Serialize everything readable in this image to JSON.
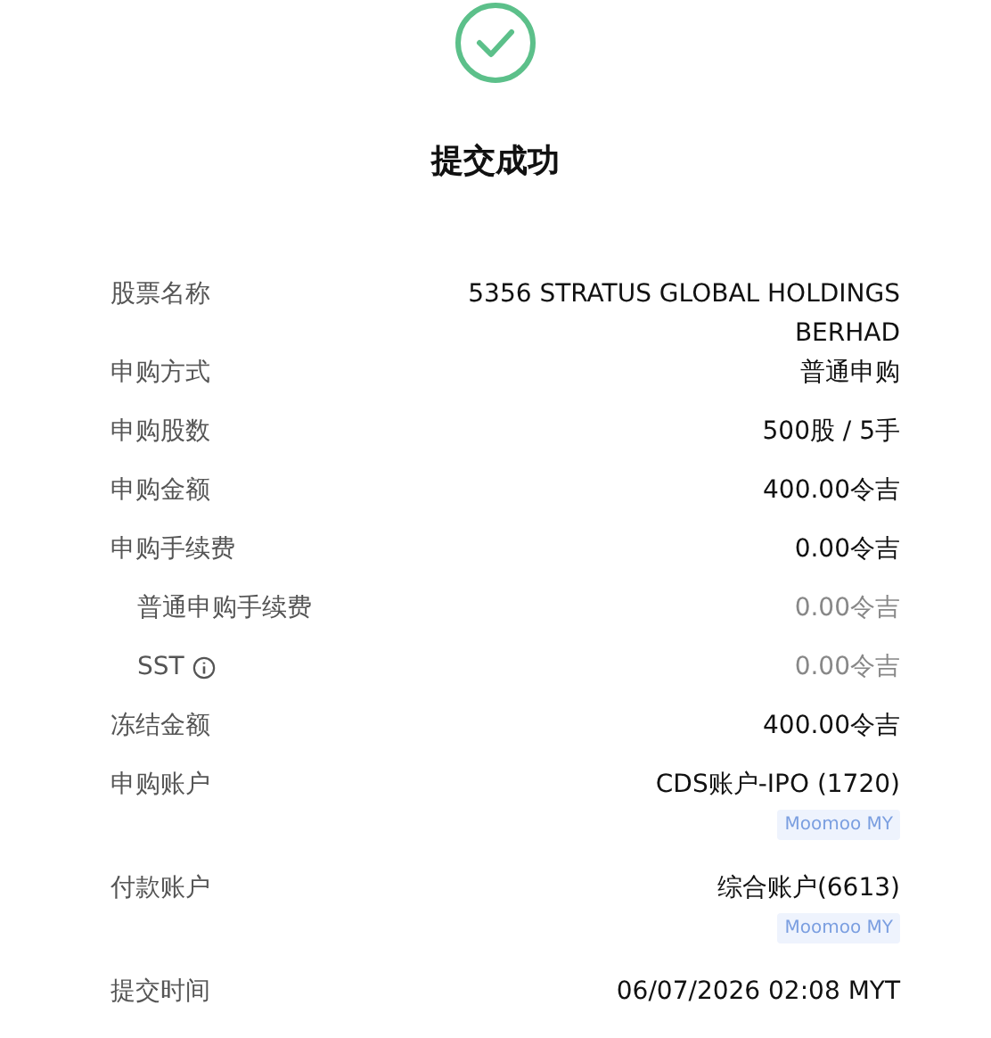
{
  "title": "提交成功",
  "rows": [
    {
      "kind": "main",
      "label": "股票名称",
      "value": "5356 STRATUS GLOBAL HOLDINGS BERHAD"
    },
    {
      "kind": "main",
      "label": "申购方式",
      "value": "普通申购"
    },
    {
      "kind": "main",
      "label": "申购股数",
      "value": "500股 / 5手"
    },
    {
      "kind": "main",
      "label": "申购金额",
      "value": "400.00令吉"
    },
    {
      "kind": "main",
      "label": "申购手续费",
      "value": "0.00令吉"
    },
    {
      "kind": "sub",
      "label": "普通申购手续费",
      "value": "0.00令吉"
    },
    {
      "kind": "sub",
      "label": "SST",
      "value": "0.00令吉",
      "info": true
    },
    {
      "kind": "main",
      "label": "冻结金额",
      "value": "400.00令吉"
    },
    {
      "kind": "main",
      "label": "申购账户",
      "value": "CDS账户-IPO (1720)",
      "tag": "Moomoo MY"
    },
    {
      "kind": "main",
      "label": "付款账户",
      "value": "综合账户(6613)",
      "tag": "Moomoo MY"
    },
    {
      "kind": "main",
      "label": "提交时间",
      "value": "06/07/2026 02:08 MYT"
    }
  ]
}
